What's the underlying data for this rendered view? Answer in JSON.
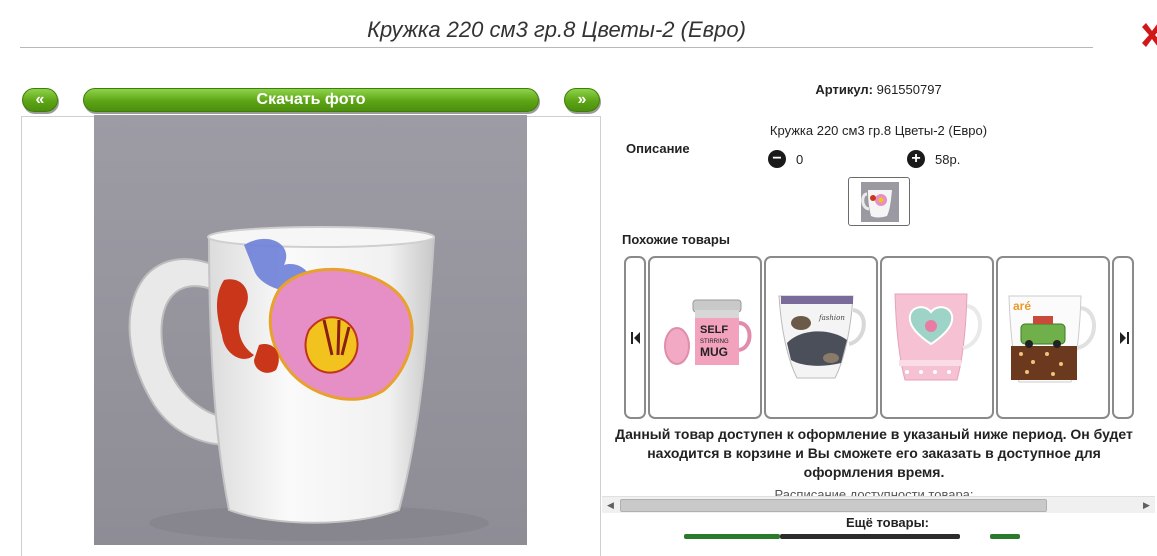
{
  "page": {
    "title": "Кружка 220 см3 гр.8 Цветы-2 (Евро)"
  },
  "gallery": {
    "prev_label": "«",
    "next_label": "»",
    "download_label": "Скачать фото"
  },
  "details": {
    "article_label": "Артикул:",
    "article_value": "961550797",
    "description_label": "Описание",
    "description_text": "Кружка 220 см3 гр.8 Цветы-2 (Евро)",
    "quantity": "0",
    "price": "58р."
  },
  "similar": {
    "label": "Похожие товары"
  },
  "notice": {
    "text": "Данный товар доступен к оформление в указаный ниже период. Он будет находится в корзине и Вы сможете его заказать в доступное для оформления время.",
    "schedule": "Расписание доступности товара:"
  },
  "more": {
    "label": "Ещё товары:"
  },
  "colors": {
    "button_green": "#5da515",
    "close_red": "#d01818",
    "link_green": "#2b7a2b"
  },
  "icons": [
    "close-icon",
    "minus-circle-icon",
    "plus-circle-icon",
    "carousel-prev-icon",
    "carousel-next-icon"
  ]
}
